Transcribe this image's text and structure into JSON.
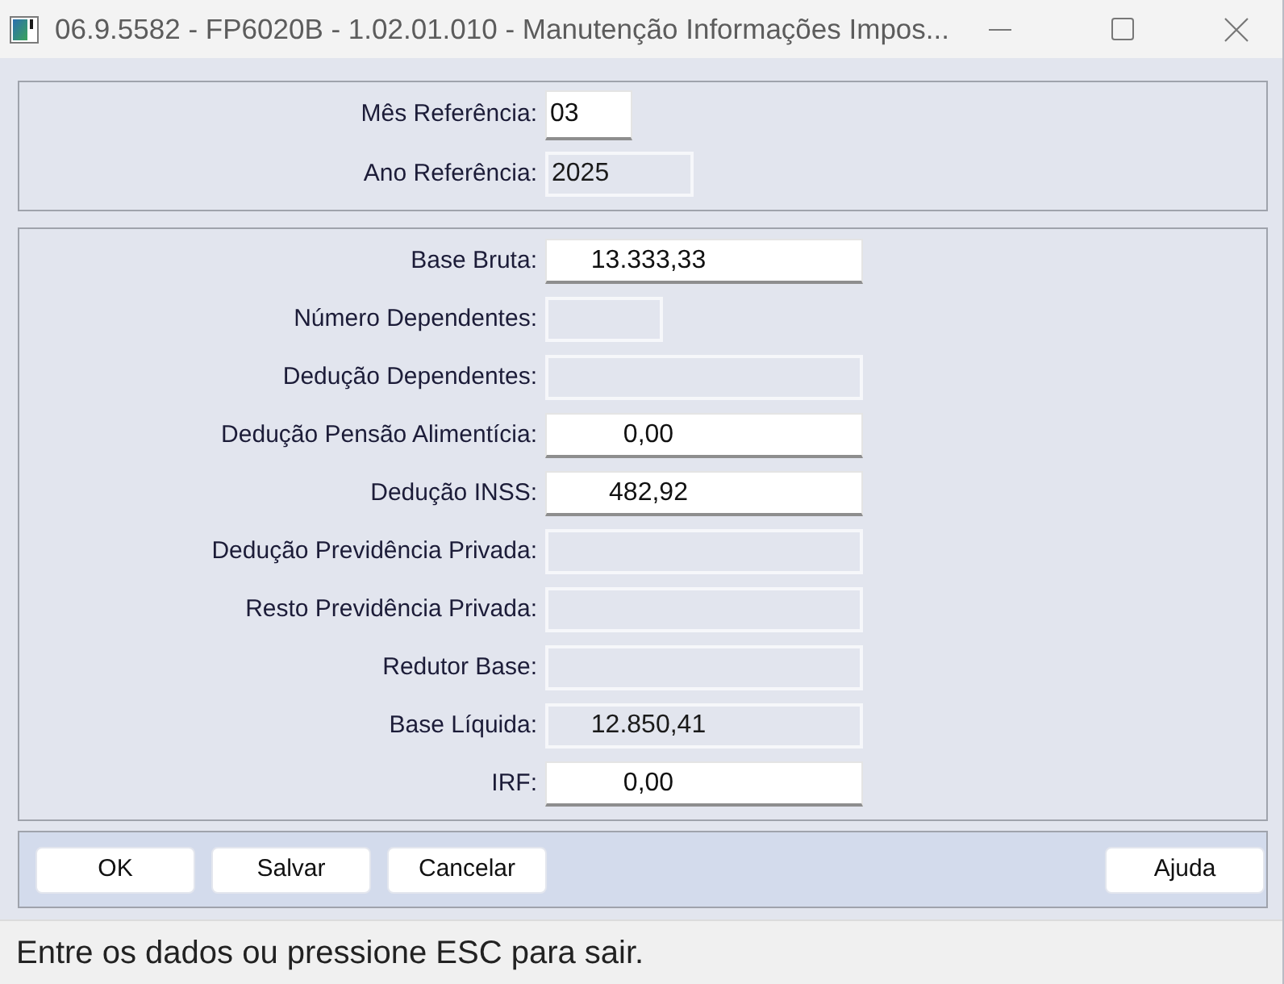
{
  "window": {
    "title": "06.9.5582 - FP6020B - 1.02.01.010 - Manutenção Informações Impos..."
  },
  "reference": {
    "fields": [
      {
        "label": "Mês Referência:",
        "value": "03",
        "kind": "narrow",
        "disabled": false
      },
      {
        "label": "Ano Referência:",
        "value": "2025",
        "kind": "medium",
        "disabled": true
      }
    ]
  },
  "tax": {
    "fields": [
      {
        "label": "Base Bruta:",
        "value": "13.333,33",
        "kind": "wide",
        "disabled": false
      },
      {
        "label": "Número Dependentes:",
        "kind": "narrow",
        "disabled": true
      },
      {
        "label": "Dedução Dependentes:",
        "kind": "wide",
        "disabled": true
      },
      {
        "label": "Dedução Pensão Alimentícia:",
        "value": "0,00",
        "kind": "wide",
        "disabled": false
      },
      {
        "label": "Dedução INSS:",
        "value": "482,92",
        "kind": "wide",
        "disabled": false
      },
      {
        "label": "Dedução Previdência Privada:",
        "kind": "wide",
        "disabled": true
      },
      {
        "label": "Resto Previdência Privada:",
        "kind": "wide",
        "disabled": true
      },
      {
        "label": "Redutor Base:",
        "kind": "wide",
        "disabled": true
      },
      {
        "label": "Base Líquida:",
        "value": "12.850,41",
        "kind": "wide",
        "disabled": true
      },
      {
        "label": "IRF:",
        "value": "0,00",
        "kind": "wide",
        "disabled": false
      }
    ]
  },
  "button_bar": {
    "left": [
      {
        "label": "OK"
      },
      {
        "label": "Salvar"
      },
      {
        "label": "Cancelar"
      }
    ],
    "right": [
      {
        "label": "Ajuda"
      }
    ]
  },
  "status_bar": {
    "text": "Entre os dados ou pressione ESC para sair."
  }
}
